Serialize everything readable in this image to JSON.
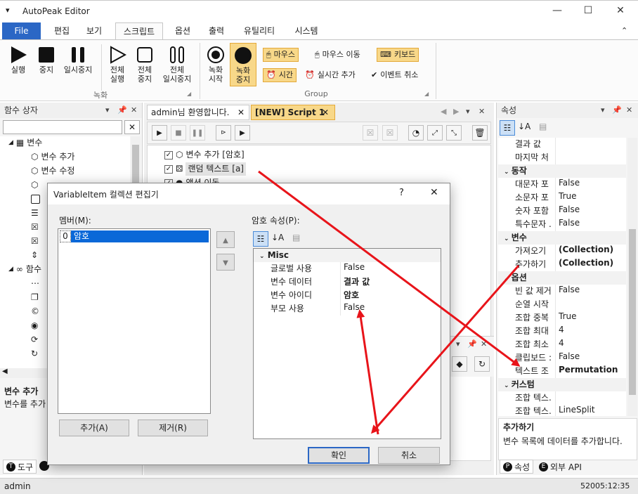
{
  "window": {
    "title": "AutoPeak Editor"
  },
  "ribbon_tabs": [
    "File",
    "편집",
    "보기",
    "스크립트",
    "옵션",
    "출력",
    "유틸리티",
    "시스템"
  ],
  "ribbon": {
    "play": "실행",
    "stop": "중지",
    "pause": "일시중지",
    "all_play": [
      "전체",
      "실행"
    ],
    "all_stop": [
      "전체",
      "중지"
    ],
    "all_pause": [
      "전체",
      "일시중지"
    ],
    "rec_start": [
      "녹화",
      "시작"
    ],
    "rec_stop": [
      "녹화",
      "중지"
    ],
    "group_record": "녹화",
    "mouse": "마우스",
    "mouse_move": "마우스 이동",
    "keyboard": "키보드",
    "time": "시간",
    "realtime_add": "실시간 추가",
    "event_cancel": "이벤트 취소",
    "group_group": "Group"
  },
  "left_panel": {
    "title": "함수 상자",
    "cat_variable": "변수",
    "var_items": [
      "변수 추가",
      "변수 수정"
    ],
    "cat_function": "함수",
    "desc_title": "변수 추가",
    "desc_text": "변수를 추가",
    "bottom_tab": "도구"
  },
  "doc_tabs": [
    "admin님 환영합니다.",
    "[NEW] Script 1"
  ],
  "script_lines": [
    "변수 추가 [암호]",
    "랜덤 텍스트 [a]",
    "액션 이동"
  ],
  "properties": {
    "title": "속성",
    "rows_top": [
      {
        "k": "결과 값",
        "v": ""
      },
      {
        "k": "마지막 처",
        "v": ""
      }
    ],
    "cat_action": "동작",
    "rows_action": [
      {
        "k": "대문자 포",
        "v": "False"
      },
      {
        "k": "소문자 포",
        "v": "True"
      },
      {
        "k": "숫자 포함",
        "v": "False"
      },
      {
        "k": "특수문자 .",
        "v": "False"
      }
    ],
    "cat_var": "변수",
    "rows_var": [
      {
        "k": "가져오기",
        "v": "(Collection)"
      },
      {
        "k": "추가하기",
        "v": "(Collection)"
      }
    ],
    "cat_opt": "옵션",
    "rows_opt": [
      {
        "k": "빈 값 제거",
        "v": "False"
      },
      {
        "k": "순열 시작",
        "v": ""
      },
      {
        "k": "조합 중복",
        "v": "True"
      },
      {
        "k": "조합 최대",
        "v": "4"
      },
      {
        "k": "조합 최소",
        "v": "4"
      },
      {
        "k": "클립보드 :",
        "v": "False"
      },
      {
        "k": "텍스트 조",
        "v": "Permutation"
      }
    ],
    "cat_custom": "커스텀",
    "rows_custom": [
      {
        "k": "조합 텍스.",
        "v": ""
      },
      {
        "k": "조합 텍스.",
        "v": "LineSplit"
      }
    ],
    "desc_title": "추가하기",
    "desc_text": "변수 목록에 데이터를 추가합니다.",
    "bottom_tabs": [
      "속성",
      "외부 API"
    ]
  },
  "dialog": {
    "title": "VariableItem 컬렉션 편집기",
    "help": "?",
    "close": "✕",
    "members_label": "멤버(M):",
    "members": [
      {
        "index": "0",
        "name": "암호"
      }
    ],
    "props_label": "암호 속성(P):",
    "cat_misc": "Misc",
    "props": [
      {
        "k": "글로벌 사용",
        "v": "False"
      },
      {
        "k": "변수 데이터",
        "v": "결과 값"
      },
      {
        "k": "변수 아이디",
        "v": "암호"
      },
      {
        "k": "부모 사용",
        "v": "False"
      }
    ],
    "add": "추가(A)",
    "remove": "제거(R)",
    "ok": "확인",
    "cancel": "취소"
  },
  "statusbar": {
    "user": "admin",
    "time": "52005:12:35"
  },
  "colors": {
    "accent": "#2b67c5",
    "arrow": "#e8141a",
    "highlight": "#f8d889"
  }
}
